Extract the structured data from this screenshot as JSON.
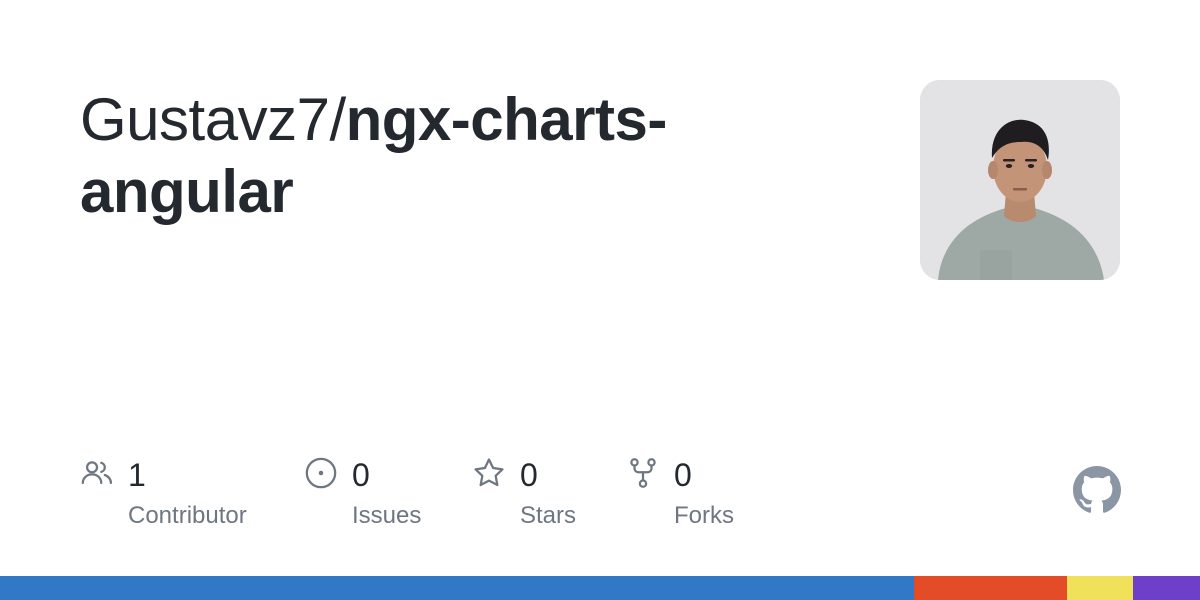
{
  "repo": {
    "owner": "Gustavz7",
    "separator": "/",
    "name": "ngx-charts-angular"
  },
  "stats": [
    {
      "value": "1",
      "label": "Contributor",
      "icon": "contributors-icon"
    },
    {
      "value": "0",
      "label": "Issues",
      "icon": "issues-icon"
    },
    {
      "value": "0",
      "label": "Stars",
      "icon": "star-icon"
    },
    {
      "value": "0",
      "label": "Forks",
      "icon": "fork-icon"
    }
  ],
  "colors": {
    "text": "#24292f",
    "muted": "#6e7781",
    "icon": "#6e7781",
    "github_logo": "#8b96a5"
  },
  "languages_bar": [
    {
      "color": "#3178c6",
      "percent": 76.2
    },
    {
      "color": "#e34c26",
      "percent": 12.7
    },
    {
      "color": "#f1e05a",
      "percent": 5.5
    },
    {
      "color": "#6e40c9",
      "percent": 5.6
    }
  ]
}
